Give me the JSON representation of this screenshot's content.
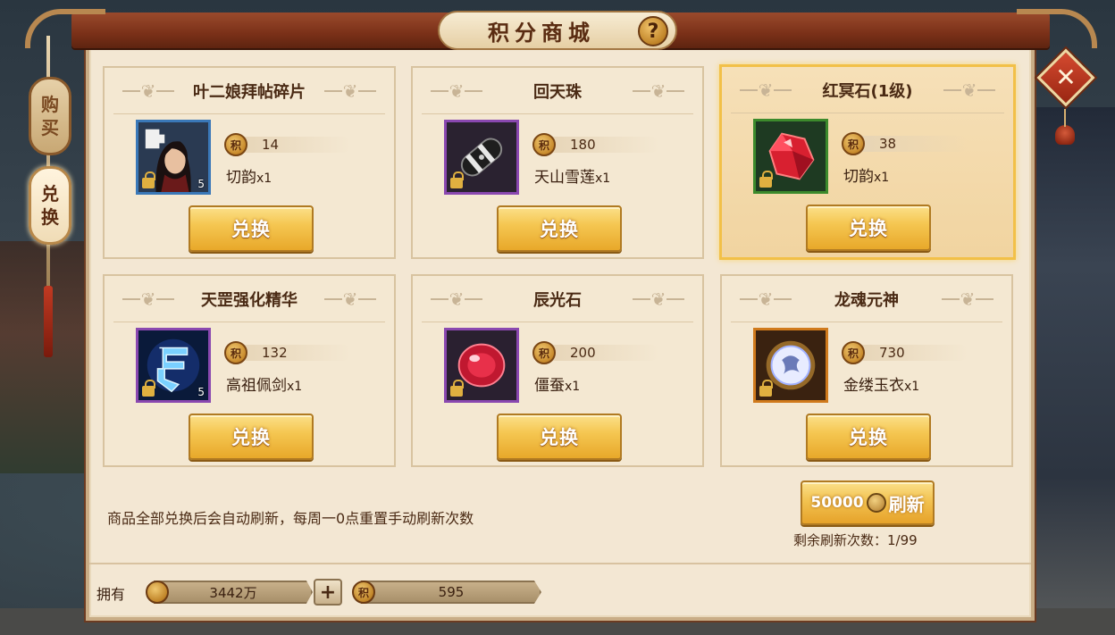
{
  "header": {
    "title": "积分商城",
    "help_glyph": "?"
  },
  "close_glyph": "✕",
  "tabs": [
    {
      "label_1": "购",
      "label_2": "买",
      "active": false
    },
    {
      "label_1": "兑",
      "label_2": "换",
      "active": true
    }
  ],
  "currency_badge": "积",
  "items": [
    {
      "name": "叶二娘拜帖碎片",
      "price": "14",
      "req_name": "切韵",
      "req_qty": "x1",
      "count": "5",
      "frame": "blue",
      "icon": "portrait-fragment-icon",
      "selected": false,
      "button": "兑换"
    },
    {
      "name": "回天珠",
      "price": "180",
      "req_name": "天山雪莲",
      "req_qty": "x1",
      "count": "",
      "frame": "purple",
      "icon": "dark-bead-icon",
      "selected": false,
      "button": "兑换"
    },
    {
      "name": "红冥石(1级)",
      "price": "38",
      "req_name": "切韵",
      "req_qty": "x1",
      "count": "",
      "frame": "green",
      "icon": "red-gem-icon",
      "selected": true,
      "button": "兑换"
    },
    {
      "name": "天罡强化精华",
      "price": "132",
      "req_name": "高祖佩剑",
      "req_qty": "x1",
      "count": "5",
      "frame": "purple",
      "icon": "blue-rune-icon",
      "selected": false,
      "button": "兑换"
    },
    {
      "name": "辰光石",
      "price": "200",
      "req_name": "僵蚕",
      "req_qty": "x1",
      "count": "",
      "frame": "purple",
      "icon": "ruby-stone-icon",
      "selected": false,
      "button": "兑换"
    },
    {
      "name": "龙魂元神",
      "price": "730",
      "req_name": "金缕玉衣",
      "req_qty": "x1",
      "count": "",
      "frame": "orange",
      "icon": "dragon-orb-icon",
      "selected": false,
      "button": "兑换"
    }
  ],
  "notice": "商品全部兑换后会自动刷新，每周一0点重置手动刷新次数",
  "refresh": {
    "cost": "50000",
    "label": "刷新",
    "remaining_text": "剩余刷新次数：1/99"
  },
  "footer": {
    "own_label": "拥有",
    "copper_amount": "3442万",
    "plus": "+",
    "points_amount": "595"
  },
  "colors": {
    "selected_border": "#f2c048",
    "button_gold": "#f5c752",
    "header_red": "#7a3018"
  }
}
